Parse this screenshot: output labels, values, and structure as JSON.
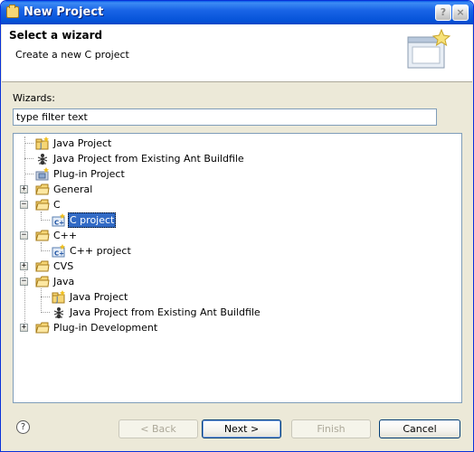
{
  "window": {
    "title": "New Project",
    "help_glyph": "?",
    "close_glyph": "×"
  },
  "banner": {
    "heading": "Select a wizard",
    "subtitle": "Create a new C project"
  },
  "wizards": {
    "label": "Wizards:",
    "filter_value": "type filter text"
  },
  "tree": {
    "items": [
      {
        "label": "Java Project",
        "icon": "java-project-icon"
      },
      {
        "label": "Java Project from Existing Ant Buildfile",
        "icon": "ant-icon"
      },
      {
        "label": "Plug-in Project",
        "icon": "plugin-project-icon"
      },
      {
        "label": "General",
        "icon": "folder-icon",
        "state": "collapsed"
      },
      {
        "label": "C",
        "icon": "folder-icon",
        "state": "expanded"
      },
      {
        "label": "C project",
        "icon": "c-project-icon",
        "selected": true
      },
      {
        "label": "C++",
        "icon": "folder-icon",
        "state": "expanded"
      },
      {
        "label": "C++ project",
        "icon": "c-project-icon"
      },
      {
        "label": "CVS",
        "icon": "folder-icon",
        "state": "collapsed"
      },
      {
        "label": "Java",
        "icon": "folder-icon",
        "state": "expanded"
      },
      {
        "label": "Java Project",
        "icon": "java-project-icon"
      },
      {
        "label": "Java Project from Existing Ant Buildfile",
        "icon": "ant-icon"
      },
      {
        "label": "Plug-in Development",
        "icon": "folder-icon",
        "state": "collapsed"
      }
    ]
  },
  "buttons": {
    "back": "< Back",
    "next": "Next >",
    "finish": "Finish",
    "cancel": "Cancel",
    "help": "?"
  },
  "colors": {
    "titlebar": "#0553d8",
    "selection": "#316ac5",
    "dialog_bg": "#ece9d8"
  }
}
